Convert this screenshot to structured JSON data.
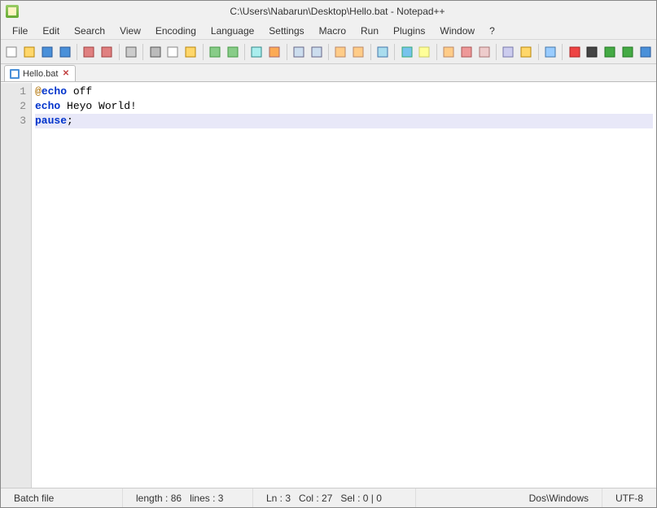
{
  "window": {
    "title": "C:\\Users\\Nabarun\\Desktop\\Hello.bat - Notepad++"
  },
  "menu": {
    "items": [
      "File",
      "Edit",
      "Search",
      "View",
      "Encoding",
      "Language",
      "Settings",
      "Macro",
      "Run",
      "Plugins",
      "Window",
      "?"
    ]
  },
  "toolbar": {
    "icons": [
      "new-file-icon",
      "open-file-icon",
      "save-icon",
      "save-all-icon",
      "sep",
      "close-icon",
      "close-all-icon",
      "sep",
      "print-icon",
      "sep",
      "cut-icon",
      "copy-icon",
      "paste-icon",
      "sep",
      "undo-icon",
      "redo-icon",
      "sep",
      "find-icon",
      "replace-icon",
      "sep",
      "zoom-in-icon",
      "zoom-out-icon",
      "sep",
      "sync-v-icon",
      "sync-h-icon",
      "sep",
      "wordwrap-icon",
      "sep",
      "all-chars-icon",
      "indent-guide-icon",
      "sep",
      "lang-icon",
      "doc-map-icon",
      "doc-list-icon",
      "sep",
      "function-list-icon",
      "folder-icon",
      "sep",
      "monitor-icon",
      "sep",
      "record-icon",
      "stop-icon",
      "play-icon",
      "play-multi-icon",
      "save-macro-icon"
    ]
  },
  "tabs": [
    {
      "label": "Hello.bat"
    }
  ],
  "editor": {
    "lines": [
      {
        "n": "1",
        "tokens": [
          {
            "t": "@",
            "cls": "at"
          },
          {
            "t": "echo",
            "cls": "kw"
          },
          {
            "t": " off",
            "cls": ""
          }
        ]
      },
      {
        "n": "2",
        "tokens": [
          {
            "t": "echo",
            "cls": "kw"
          },
          {
            "t": " Heyo World!",
            "cls": ""
          }
        ]
      },
      {
        "n": "3",
        "tokens": [
          {
            "t": "pause",
            "cls": "kw"
          },
          {
            "t": ";",
            "cls": ""
          }
        ],
        "current": true
      }
    ]
  },
  "status": {
    "file_type": "Batch file",
    "length_label": "length : 86",
    "lines_label": "lines : 3",
    "ln_label": "Ln : 3",
    "col_label": "Col : 27",
    "sel_label": "Sel : 0 | 0",
    "eol": "Dos\\Windows",
    "encoding": "UTF-8"
  }
}
